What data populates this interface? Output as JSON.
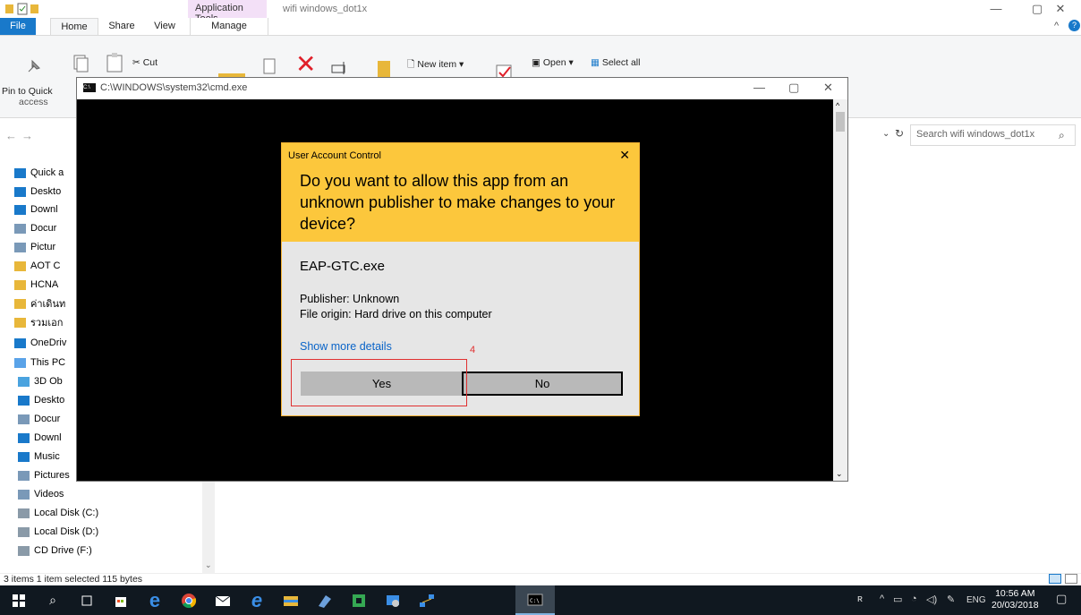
{
  "explorer": {
    "app_tools": "Application Tools",
    "title": "wifi windows_dot1x",
    "tabs": {
      "file": "File",
      "home": "Home",
      "share": "Share",
      "view": "View",
      "manage": "Manage"
    },
    "ribbon": {
      "pin": "Pin to Quick",
      "pin2": "access",
      "cut": "Cut",
      "new_item": "New item",
      "open": "Open",
      "select_all": "Select all"
    },
    "search_placeholder": "Search wifi windows_dot1x",
    "nav": [
      "Quick a",
      "Deskto",
      "Downl",
      "Docur",
      "Pictur",
      "AOT C",
      "HCNA",
      "ค่าเดินท",
      "รวมเอก",
      "OneDriv",
      "This PC",
      "3D Ob",
      "Deskto",
      "Docur",
      "Downl",
      "Music",
      "Pictures",
      "Videos",
      "Local Disk (C:)",
      "Local Disk (D:)",
      "CD Drive (F:)"
    ],
    "status": "3 items    1 item selected  115 bytes"
  },
  "cmd": {
    "title": "C:\\WINDOWS\\system32\\cmd.exe"
  },
  "uac": {
    "header": "User Account Control",
    "question": "Do you want to allow this app from an unknown publisher to make changes to your device?",
    "exe": "EAP-GTC.exe",
    "publisher": "Publisher: Unknown",
    "origin": "File origin: Hard drive on this computer",
    "more": "Show more details",
    "yes": "Yes",
    "no": "No",
    "annotation": "4"
  },
  "taskbar": {
    "time": "10:56 AM",
    "date": "20/03/2018",
    "lang": "ENG"
  },
  "colors": {
    "uac_header": "#fcc73c",
    "accent": "#1979ca",
    "taskbar": "#101820"
  }
}
